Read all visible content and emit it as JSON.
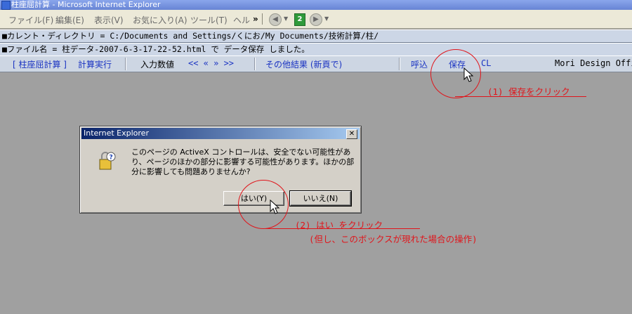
{
  "window": {
    "title": "柱座屈計算 - Microsoft Internet Explorer"
  },
  "menu": {
    "items": [
      "ファイル(F)",
      "編集(E)",
      "表示(V)",
      "お気に入り(A)",
      "ツール(T)",
      "ヘル"
    ],
    "more": "»"
  },
  "info": {
    "current_dir": "■カレント・ディレクトリ =  C:/Documents and Settings/くにお/My Documents/技術計算/柱/",
    "file_line": "■ファイル名 =  柱データ-2007-6-3-17-22-52.html で データ保存 しました。"
  },
  "cmdbar": {
    "title": "[ 柱座屈計算 ]",
    "calc": "計算実行",
    "input_label": "入力数値",
    "nav": "<< « » >>",
    "other": "その他結果 (新頁で)",
    "load": "呼込",
    "save": "保存",
    "cl": "CL",
    "brand": "Mori Design Offi"
  },
  "annotations": {
    "step1": "(1) 保存をクリック",
    "step2": "(2) はい をクリック",
    "step2_note": "(但し、このボックスが現れた場合の操作)"
  },
  "dialog": {
    "title": "Internet Explorer",
    "close": "✕",
    "message": "このページの ActiveX コントロールは、安全でない可能性があり、ページのほかの部分に影響する可能性があります。ほかの部分に影響しても問題ありませんか?",
    "yes": "はい(Y)",
    "no": "いいえ(N)"
  },
  "colors": {
    "annotation": "#e0151b",
    "command_link": "#1a33c2"
  }
}
